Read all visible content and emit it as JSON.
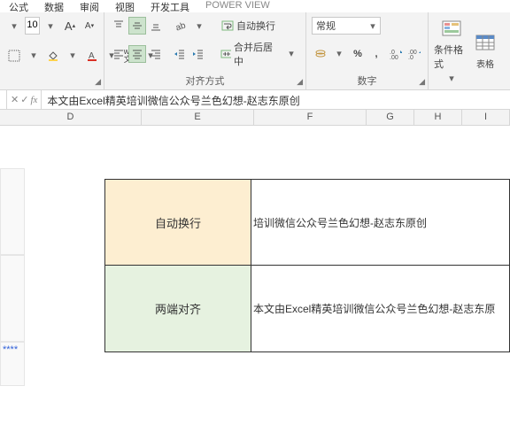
{
  "menu": {
    "m1": "公式",
    "m2": "数据",
    "m3": "审阅",
    "m4": "视图",
    "m5": "开发工具",
    "m6": "POWER VIEW"
  },
  "font": {
    "size": "10",
    "tip_inc": "A",
    "tip_dec": "A"
  },
  "align": {
    "wrap": "自动换行",
    "merge": "合并后居中",
    "group": "对齐方式"
  },
  "number": {
    "format": "常规",
    "percent": "%",
    "group": "数字"
  },
  "styles": {
    "condfmt": "条件格式",
    "tablefmt": "套用\n表格"
  },
  "fbar": {
    "cancel": "✕",
    "confirm": "✓",
    "fx": "fx",
    "formula": "本文由Excel精英培训微信公众号兰色幻想-赵志东原创"
  },
  "cols": {
    "D": "D",
    "E": "E",
    "F": "F",
    "G": "G",
    "H": "H",
    "I": "I"
  },
  "stars": "****",
  "cells": {
    "r1label": "自动换行",
    "r1text": "培训微信公众号兰色幻想-赵志东原创",
    "r2label": "两端对齐",
    "r2text": "本文由Excel精英培训微信公众号兰色幻想-赵志东原"
  }
}
